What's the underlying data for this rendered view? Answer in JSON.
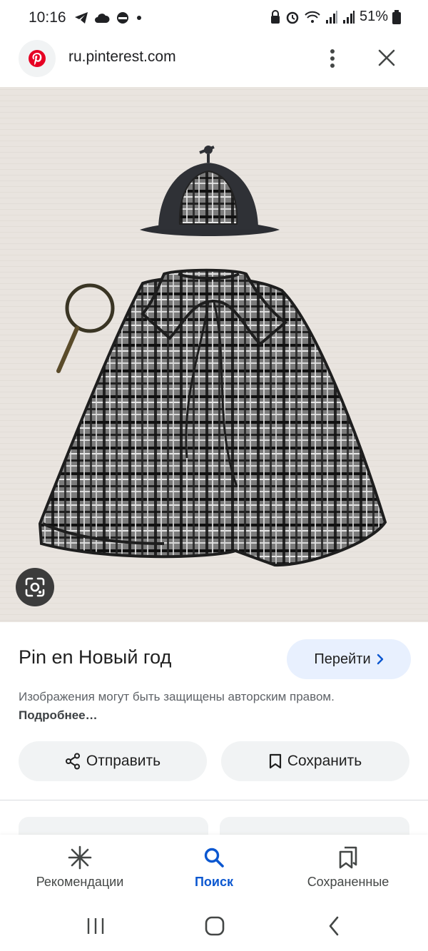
{
  "status": {
    "time": "10:16",
    "battery": "51%"
  },
  "browser": {
    "url": "ru.pinterest.com"
  },
  "pin": {
    "title": "Pin en Новый год",
    "visit_label": "Перейти",
    "copyright_text": "Изображения могут быть защищены авторским правом. ",
    "more_link": "Подробнее…",
    "share_label": "Отправить",
    "save_label": "Сохранить"
  },
  "bottom_nav": {
    "items": [
      {
        "label": "Рекомендации",
        "icon": "asterisk-icon",
        "active": false
      },
      {
        "label": "Поиск",
        "icon": "search-icon",
        "active": true
      },
      {
        "label": "Сохраненные",
        "icon": "bookmarks-icon",
        "active": false
      }
    ]
  },
  "colors": {
    "accent": "#0b57d0",
    "pinterest_red": "#e60023",
    "visit_button_bg": "#e8f0fe"
  }
}
